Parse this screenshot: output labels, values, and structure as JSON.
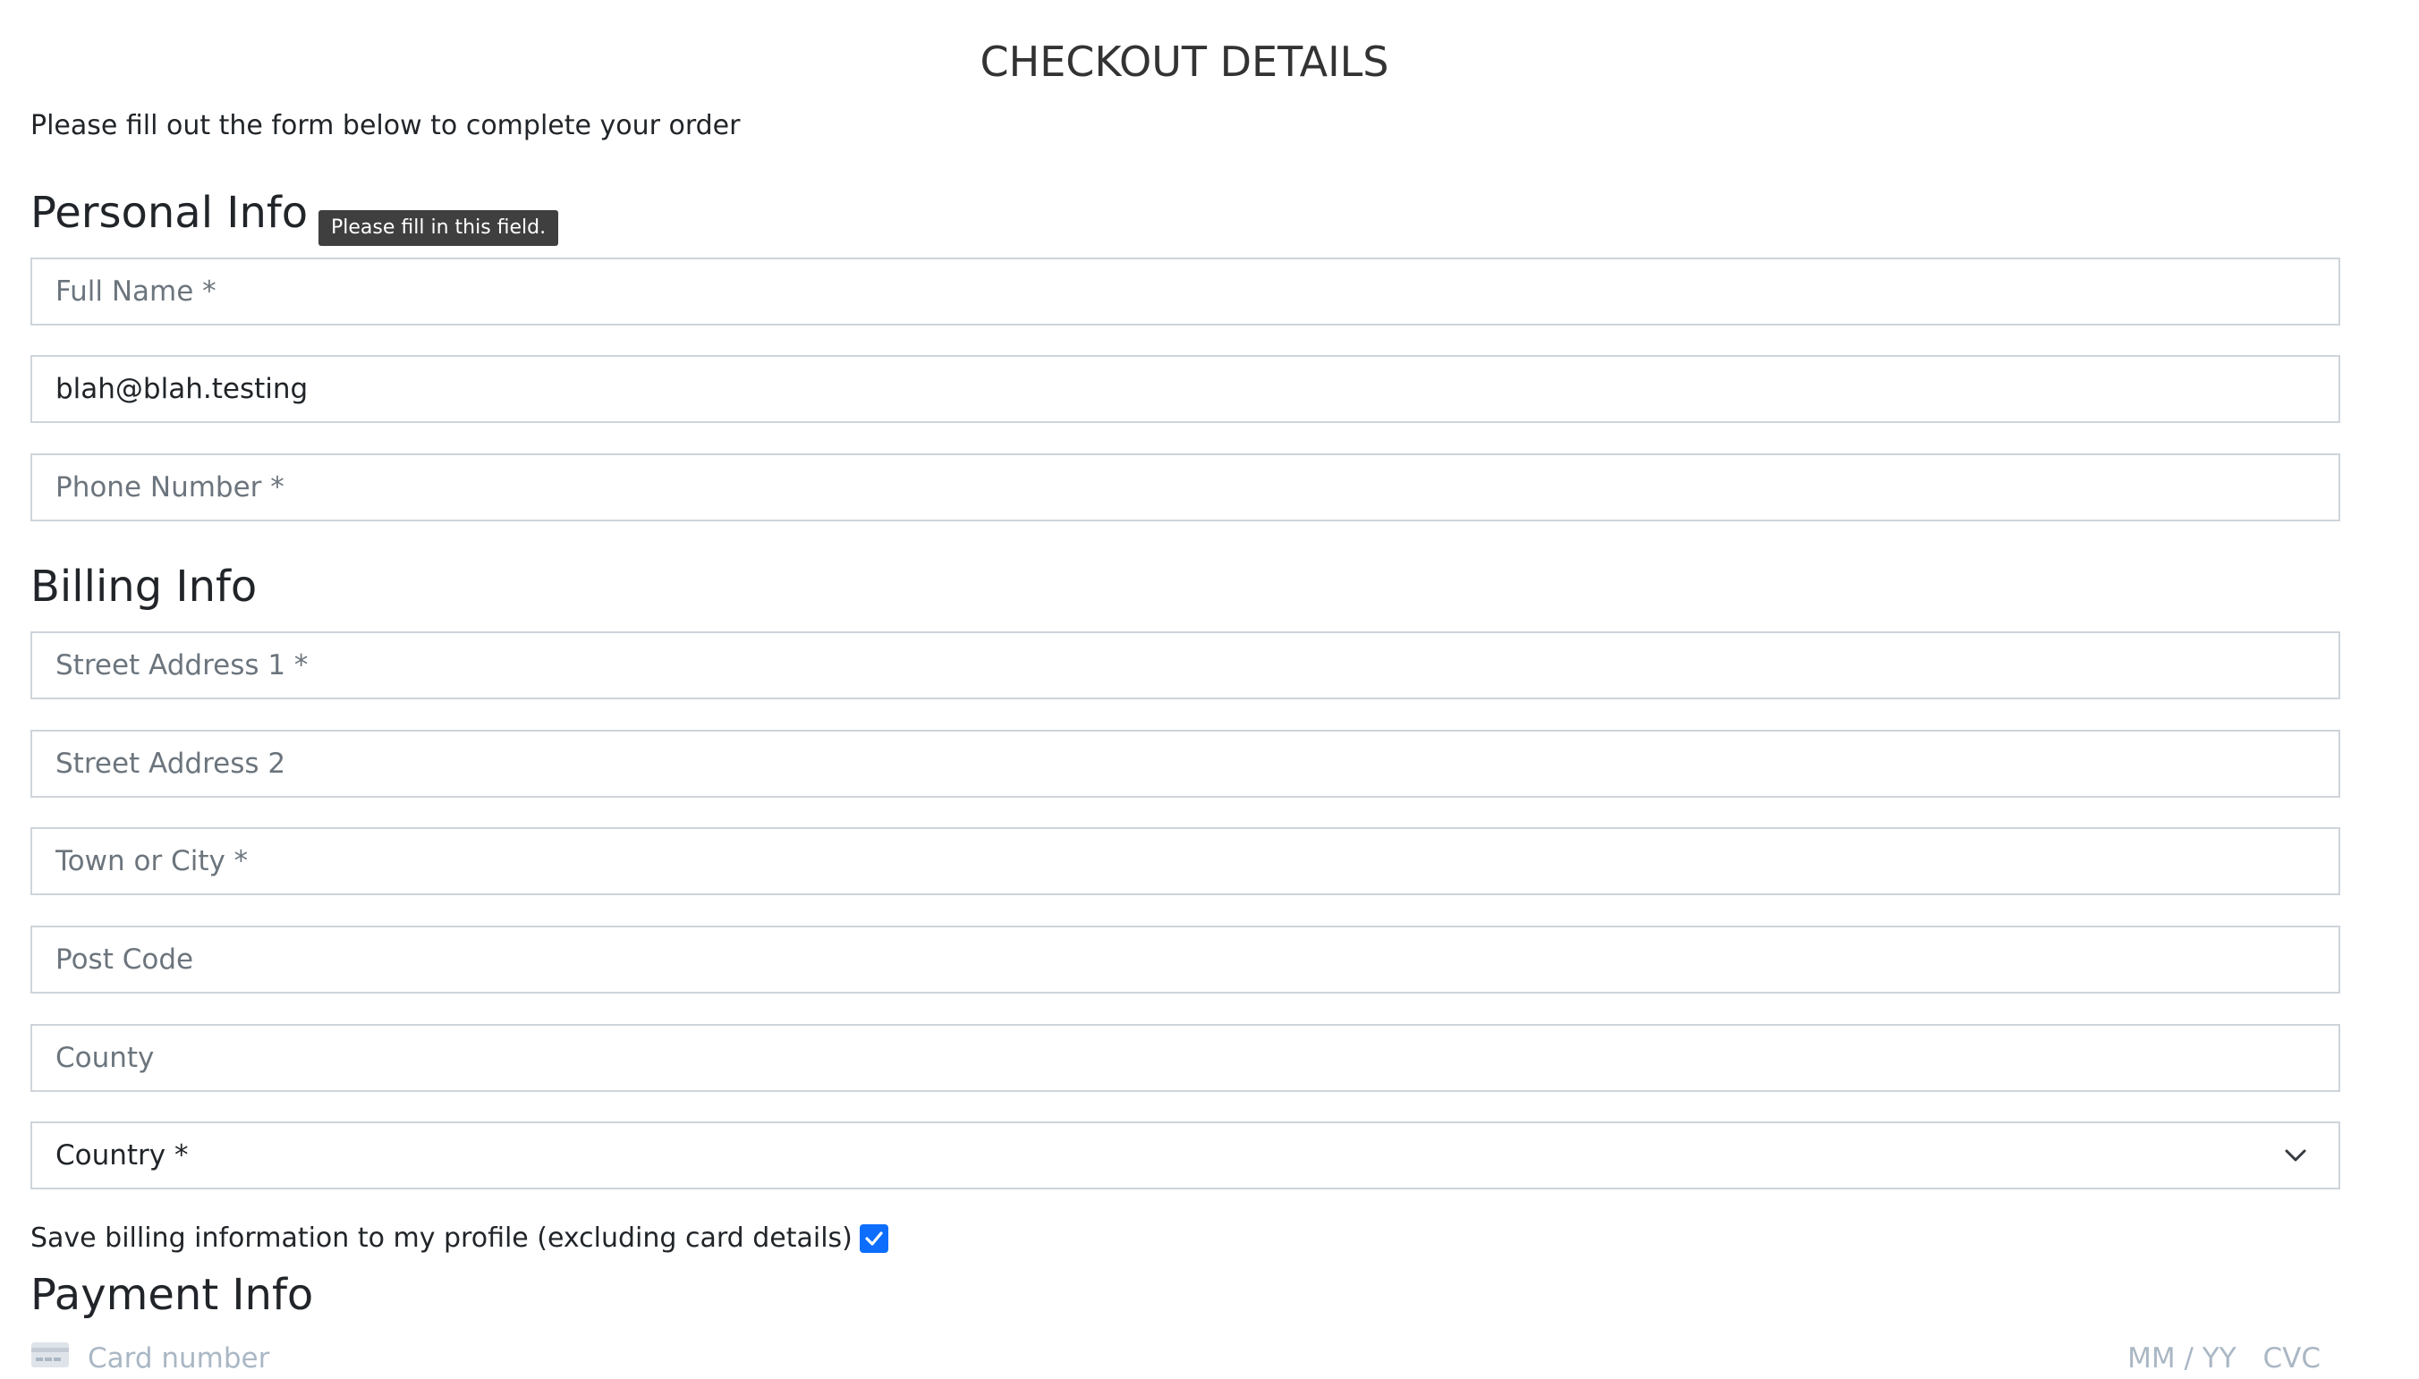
{
  "page": {
    "title": "CHECKOUT DETAILS",
    "intro": "Please fill out the form below to complete your order"
  },
  "personal": {
    "heading": "Personal Info",
    "full_name_placeholder": "Full Name *",
    "email_value": "blah@blah.testing",
    "phone_placeholder": "Phone Number *",
    "tooltip": "Please fill in this field."
  },
  "billing": {
    "heading": "Billing Info",
    "street1_placeholder": "Street Address 1 *",
    "street2_placeholder": "Street Address 2",
    "town_placeholder": "Town or City *",
    "postcode_placeholder": "Post Code",
    "county_placeholder": "County",
    "country_selected": "Country *",
    "save_label": "Save billing information to my profile (excluding card details)",
    "save_checked": true
  },
  "payment": {
    "heading": "Payment Info",
    "card_number_placeholder": "Card number",
    "expiry_placeholder": "MM / YY",
    "cvc_placeholder": "CVC"
  },
  "colors": {
    "accent": "#0d6efd",
    "border": "#ced4da",
    "placeholder": "#6c757d",
    "card_placeholder": "#aab7c4",
    "tooltip_bg": "#3f3f3f"
  },
  "icons": {
    "country_dropdown": "chevron-down-icon",
    "save_checkbox": "check-icon",
    "card": "credit-card-icon"
  }
}
